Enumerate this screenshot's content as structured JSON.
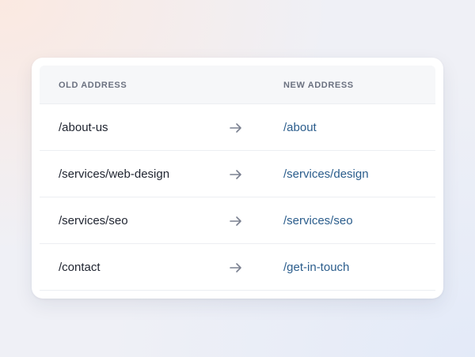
{
  "table": {
    "headers": {
      "old": "OLD ADDRESS",
      "new": "NEW ADDRESS"
    },
    "rows": [
      {
        "old": "/about-us",
        "new": "/about"
      },
      {
        "old": "/services/web-design",
        "new": "/services/design"
      },
      {
        "old": "/services/seo",
        "new": "/services/seo"
      },
      {
        "old": "/contact",
        "new": "/get-in-touch"
      }
    ]
  },
  "colors": {
    "link": "#2b5d8c",
    "text": "#1f2430",
    "header_text": "#6b7180",
    "arrow": "#7a8090"
  },
  "icons": {
    "row_arrow": "arrow-right-icon"
  }
}
